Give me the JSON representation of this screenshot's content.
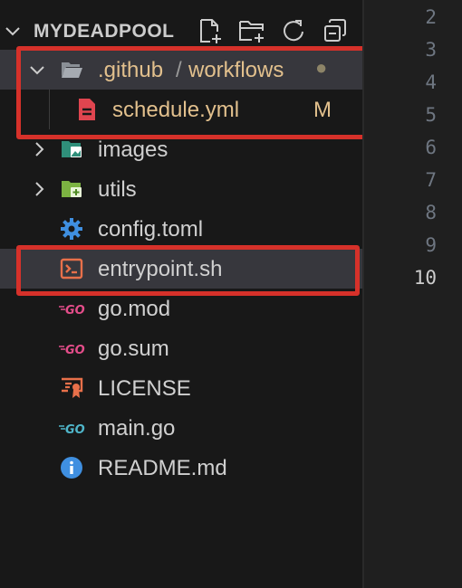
{
  "explorer": {
    "title": "MYDEADPOOL",
    "actions": [
      "new-file-icon",
      "new-folder-icon",
      "refresh-icon",
      "collapse-all-icon"
    ]
  },
  "tree": {
    "folder_path": {
      "part1": ".github",
      "separator": "/",
      "part2": "workflows",
      "status_dot": "●"
    },
    "schedule": {
      "label": "schedule.yml",
      "badge": "M"
    },
    "images": "images",
    "utils": "utils",
    "config": "config.toml",
    "entrypoint": "entrypoint.sh",
    "gomod": "go.mod",
    "gosum": "go.sum",
    "license": "LICENSE",
    "maingo": "main.go",
    "readme": "README.md"
  },
  "editor": {
    "line_numbers": [
      "2",
      "3",
      "4",
      "5",
      "6",
      "7",
      "8",
      "9",
      "10"
    ],
    "current_line": "10"
  },
  "colors": {
    "modified": "#e2c08d",
    "highlight": "#d6312a",
    "selection": "#37373d",
    "go_icon": "#e44d8a",
    "go_main_icon": "#4fb5c9",
    "gear_icon": "#3f8fe0",
    "terminal_icon": "#e8704a"
  }
}
